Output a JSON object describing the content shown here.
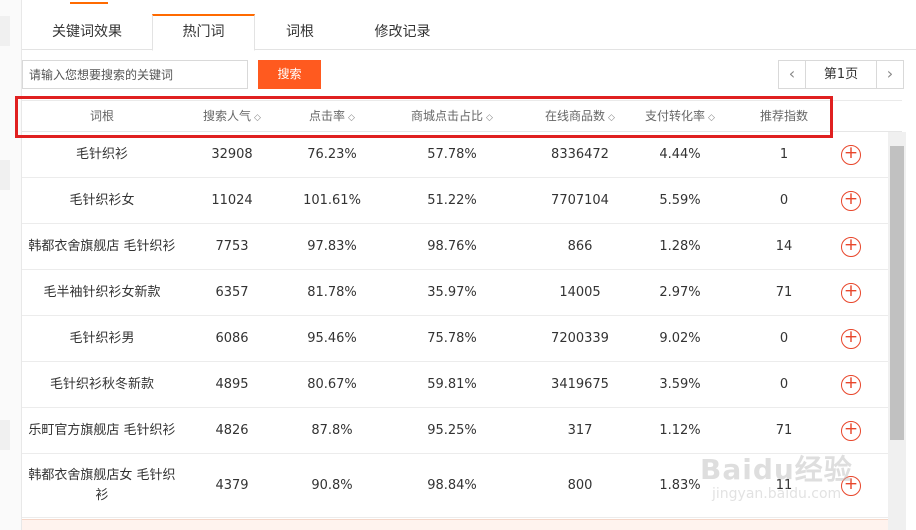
{
  "tabs": [
    {
      "label": "关键词效果"
    },
    {
      "label": "热门词"
    },
    {
      "label": "词根"
    },
    {
      "label": "修改记录"
    }
  ],
  "search": {
    "placeholder": "请输入您想要搜索的关键词",
    "button_label": "搜索"
  },
  "pager": {
    "prev": "‹",
    "page_label": "第1页",
    "next": "›"
  },
  "columns": [
    "词根",
    "搜索人气",
    "点击率",
    "商城点击占比",
    "在线商品数",
    "支付转化率",
    "推荐指数"
  ],
  "sortable": [
    false,
    true,
    true,
    true,
    true,
    true,
    false
  ],
  "sort_glyph": "◇",
  "add_glyph": "+",
  "rows": [
    {
      "word": "毛针织衫",
      "popularity": "32908",
      "ctr": "76.23%",
      "mall_ctr": "57.78%",
      "items": "8336472",
      "conversion": "4.44%",
      "index": "1"
    },
    {
      "word": "毛针织衫女",
      "popularity": "11024",
      "ctr": "101.61%",
      "mall_ctr": "51.22%",
      "items": "7707104",
      "conversion": "5.59%",
      "index": "0"
    },
    {
      "word": "韩都衣舍旗舰店 毛针织衫",
      "popularity": "7753",
      "ctr": "97.83%",
      "mall_ctr": "98.76%",
      "items": "866",
      "conversion": "1.28%",
      "index": "14"
    },
    {
      "word": "毛半袖针织衫女新款",
      "popularity": "6357",
      "ctr": "81.78%",
      "mall_ctr": "35.97%",
      "items": "14005",
      "conversion": "2.97%",
      "index": "71"
    },
    {
      "word": "毛针织衫男",
      "popularity": "6086",
      "ctr": "95.46%",
      "mall_ctr": "75.78%",
      "items": "7200339",
      "conversion": "9.02%",
      "index": "0"
    },
    {
      "word": "毛针织衫秋冬新款",
      "popularity": "4895",
      "ctr": "80.67%",
      "mall_ctr": "59.81%",
      "items": "3419675",
      "conversion": "3.59%",
      "index": "0"
    },
    {
      "word": "乐町官方旗舰店 毛针织衫",
      "popularity": "4826",
      "ctr": "87.8%",
      "mall_ctr": "95.25%",
      "items": "317",
      "conversion": "1.12%",
      "index": "71"
    },
    {
      "word": "韩都衣舍旗舰店女 毛针织衫",
      "popularity": "4379",
      "ctr": "90.8%",
      "mall_ctr": "98.84%",
      "items": "800",
      "conversion": "1.83%",
      "index": "11"
    }
  ],
  "watermark": {
    "main": "Baidu经验",
    "sub": "jingyan.baidu.com"
  },
  "colors": {
    "accent": "#ff5a1f",
    "highlight": "#e02020",
    "add_icon": "#e8462b"
  }
}
